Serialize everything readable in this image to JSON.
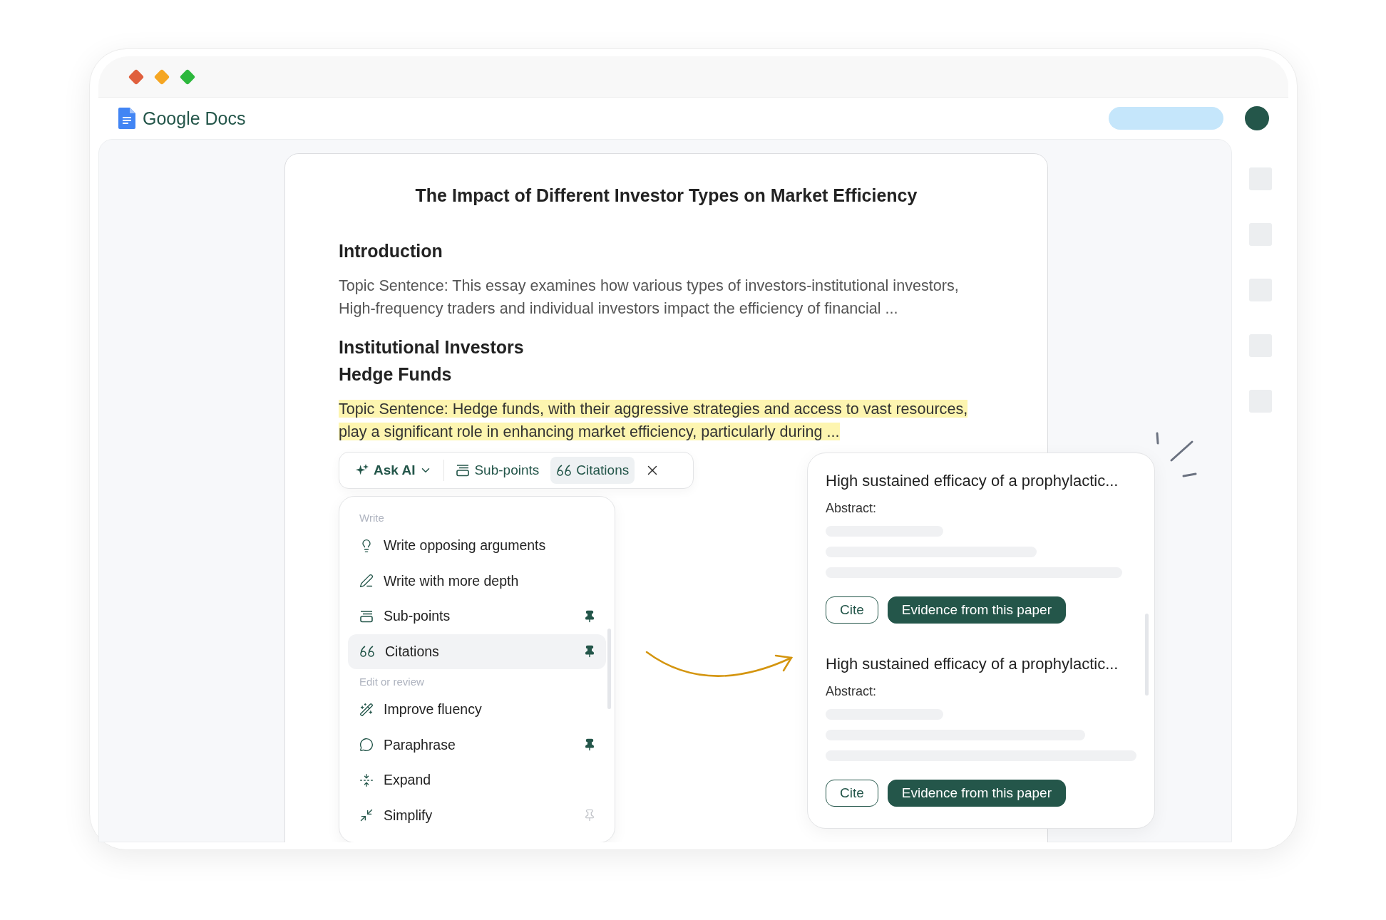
{
  "window": {
    "controls": [
      {
        "color": "#e0603e"
      },
      {
        "color": "#f5a623"
      },
      {
        "color": "#2db83d"
      }
    ]
  },
  "app": {
    "name": "Google Docs"
  },
  "document": {
    "title": "The Impact of Different Investor Types on Market Efficiency",
    "blocks": [
      {
        "kind": "heading",
        "text": "Introduction"
      },
      {
        "kind": "paragraph",
        "text": "Topic Sentence: This essay examines how various types of investors-institutional investors, High-frequency traders and individual investors impact the efficiency of financial ...",
        "highlighted": false
      },
      {
        "kind": "heading",
        "text": "Institutional Investors"
      },
      {
        "kind": "subheading",
        "text": "Hedge Funds"
      },
      {
        "kind": "paragraph",
        "text": "Topic Sentence: Hedge funds, with their aggressive strategies and access to vast resources, play a significant role in enhancing market efficiency, particularly during ...",
        "highlighted": true
      }
    ]
  },
  "toolbar": {
    "items": [
      {
        "kind": "dropdown",
        "label": "Ask AI",
        "selected": false
      },
      {
        "kind": "action",
        "label": "Sub-points",
        "selected": false
      },
      {
        "kind": "action",
        "label": "Citations",
        "selected": true
      }
    ]
  },
  "menu": {
    "groups": [
      {
        "title": "Write",
        "items": [
          {
            "label": "Write opposing arguments",
            "selected": false
          },
          {
            "label": "Write with more depth",
            "selected": false
          },
          {
            "label": "Sub-points",
            "pinned": true,
            "selected": false
          },
          {
            "label": "Citations",
            "pinned": true,
            "selected": true
          }
        ]
      },
      {
        "title": "Edit or review",
        "items": [
          {
            "label": "Improve fluency",
            "selected": false
          },
          {
            "label": "Paraphrase",
            "pinned": true,
            "selected": false
          },
          {
            "label": "Expand",
            "selected": false
          },
          {
            "label": "Simplify",
            "pinned": false,
            "selected": false
          }
        ]
      }
    ]
  },
  "results": [
    {
      "title": "High sustained efficacy of a prophylactic...",
      "abstract_label": "Abstract:",
      "buttons": [
        {
          "kind": "outline",
          "label": "Cite"
        },
        {
          "kind": "solid",
          "label": "Evidence from this paper"
        }
      ]
    },
    {
      "title": "High sustained efficacy of a prophylactic...",
      "abstract_label": "Abstract:",
      "buttons": [
        {
          "kind": "outline",
          "label": "Cite"
        },
        {
          "kind": "solid",
          "label": "Evidence from this paper"
        }
      ]
    }
  ]
}
